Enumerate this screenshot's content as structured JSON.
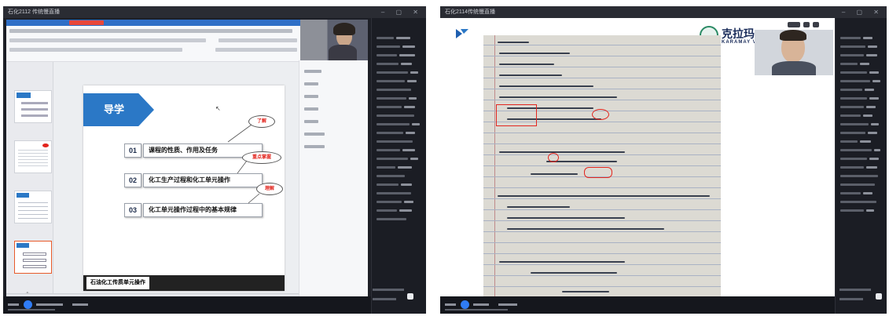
{
  "left_window": {
    "title": "石化2112 传统慢直播",
    "controls": "",
    "slide": {
      "heading": "导学",
      "items": [
        {
          "num": "01",
          "text": "课程的性质、作用及任务"
        },
        {
          "num": "02",
          "text": "化工生产过程和化工单元操作"
        },
        {
          "num": "03",
          "text": "化工单元操作过程中的基本规律"
        }
      ],
      "bubbles": [
        "了解",
        "重点掌握",
        "理解"
      ],
      "footer": "石油化工传质单元操作"
    },
    "colors": {
      "accent": "#2b78c6",
      "bubble_text": "#e2241d"
    }
  },
  "right_window": {
    "title": "石化2114传统慢直播",
    "logo": {
      "text": "克拉玛",
      "sub": "KARAMAY VOC"
    }
  }
}
